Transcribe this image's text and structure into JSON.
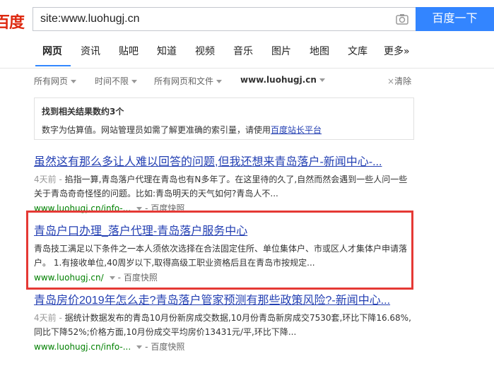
{
  "logo": "百度",
  "search": {
    "value": "site:www.luohugj.cn",
    "button": "百度一下"
  },
  "tabs": [
    "网页",
    "资讯",
    "贴吧",
    "知道",
    "视频",
    "音乐",
    "图片",
    "地图",
    "文库",
    "更多»"
  ],
  "filters": {
    "page": "所有网页",
    "time": "时间不限",
    "type": "所有网页和文件",
    "site": "www.luohugj.cn",
    "clear": "清除"
  },
  "notice": {
    "title": "找到相关结果数约3个",
    "text": "数字为估算值。网站管理员如需了解更准确的索引量，请使用",
    "link": "百度站长平台"
  },
  "results": [
    {
      "title": "虽然这有那么多让人难以回答的问题,但我还想来青岛落户-新闻中心-...",
      "date": "4天前 - ",
      "abstract": "掐指一算,青岛落户代理在青岛也有N多年了。在这里待的久了,自然而然会遇到一些人问一些关于青岛奇奇怪怪的问题。比如:青岛明天的天气如何?青岛人不...",
      "url": "www.luohugj.cn/info-...",
      "snapshot": "- 百度快照"
    },
    {
      "title": "青岛户口办理_落户代理-青岛落户服务中心",
      "date": "",
      "abstract": "青岛技工满足以下条件之一本人须依次选择在合法固定住所、单位集体户、市或区人才集体户申请落户。 1.有接收单位,40周岁以下,取得高级工职业资格后且在青岛市按规定...",
      "url": "www.luohugj.cn/",
      "snapshot": "- 百度快照"
    },
    {
      "title": "青岛房价2019年怎么走?青岛落户管家预测有那些政策风险?-新闻中心...",
      "date": "4天前 - ",
      "abstract": "据统计数据发布的青岛10月份新房成交数据,10月份青岛新房成交7530套,环比下降16.68%,同比下降52%;价格方面,10月份成交平均房价13431元/平,环比下降...",
      "url": "www.luohugj.cn/info-...",
      "snapshot": "- 百度快照"
    }
  ],
  "colors": {
    "brand_blue": "#3385ff",
    "link": "#2440b3",
    "url_green": "#008000",
    "highlight_red": "#e53935"
  }
}
